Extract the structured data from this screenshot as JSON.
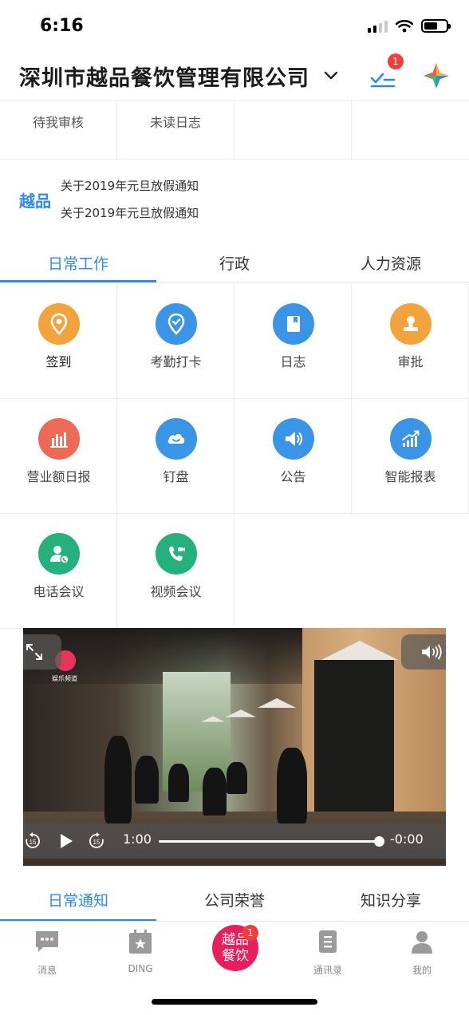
{
  "status_bar": {
    "time": "6:16"
  },
  "header": {
    "company_name": "深圳市越品餐饮管理有限公司",
    "todo_badge": "1"
  },
  "review_row": {
    "items": [
      "待我审核",
      "未读日志",
      ""
    ]
  },
  "notice": {
    "brand": "越品",
    "lines": [
      "关于2019年元旦放假通知",
      "关于2019年元旦放假通知"
    ]
  },
  "top_tabs": [
    {
      "label": "日常工作",
      "active": true
    },
    {
      "label": "行政",
      "active": false
    },
    {
      "label": "人力资源",
      "active": false
    }
  ],
  "apps": [
    {
      "label": "签到",
      "icon": "location-pin-icon",
      "color": "#f3a33c"
    },
    {
      "label": "考勤打卡",
      "icon": "check-pin-icon",
      "color": "#3b95e6"
    },
    {
      "label": "日志",
      "icon": "notebook-icon",
      "color": "#3b95e6"
    },
    {
      "label": "审批",
      "icon": "stamp-icon",
      "color": "#f3a33c"
    },
    {
      "label": "营业额日报",
      "icon": "bar-chart-icon",
      "color": "#ee6a57"
    },
    {
      "label": "钉盘",
      "icon": "cloud-icon",
      "color": "#3b95e6"
    },
    {
      "label": "公告",
      "icon": "megaphone-icon",
      "color": "#3b95e6"
    },
    {
      "label": "智能报表",
      "icon": "trend-chart-icon",
      "color": "#3b95e6"
    },
    {
      "label": "电话会议",
      "icon": "user-phone-icon",
      "color": "#25b07d"
    },
    {
      "label": "视频会议",
      "icon": "video-call-icon",
      "color": "#25b07d"
    }
  ],
  "video": {
    "current_time": "1:00",
    "remaining_time": "-0:00",
    "progress": 1.0,
    "logo_text": "娱乐频道"
  },
  "bottom_tabs": [
    {
      "label": "日常通知",
      "active": true
    },
    {
      "label": "公司荣誉",
      "active": false
    },
    {
      "label": "知识分享",
      "active": false
    }
  ],
  "bottom_nav": {
    "items": [
      {
        "label": "消息",
        "icon": "message-icon"
      },
      {
        "label": "DING",
        "icon": "ding-icon"
      },
      {
        "label": "通讯录",
        "icon": "contacts-icon"
      },
      {
        "label": "我的",
        "icon": "profile-icon"
      }
    ],
    "center_label_1": "越品",
    "center_label_2": "餐饮",
    "center_badge": "1"
  },
  "colors": {
    "accent": "#2f8ae5",
    "badge": "#f23d3d",
    "brand_pink": "#e81f5e"
  }
}
